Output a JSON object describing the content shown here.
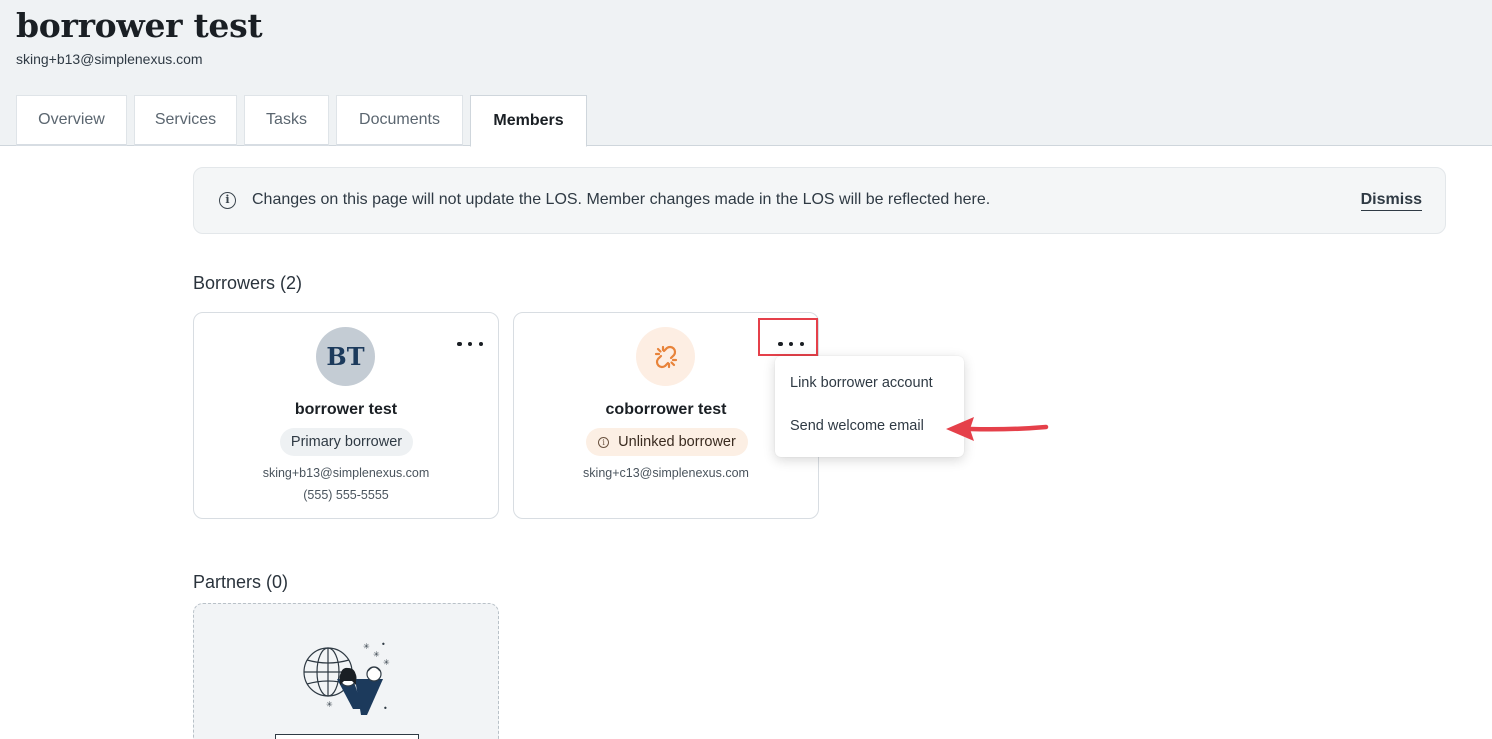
{
  "header": {
    "title": "borrower test",
    "subtitle": "sking+b13@simplenexus.com"
  },
  "tabs": [
    {
      "label": "Overview"
    },
    {
      "label": "Services"
    },
    {
      "label": "Tasks"
    },
    {
      "label": "Documents"
    },
    {
      "label": "Members",
      "active": true
    }
  ],
  "banner": {
    "icon": "info-icon",
    "text": "Changes on this page will not update the LOS. Member changes made in the LOS will be reflected here.",
    "dismiss_label": "Dismiss"
  },
  "borrowers": {
    "title": "Borrowers (2)",
    "cards": [
      {
        "avatar_initials": "BT",
        "name": "borrower test",
        "role": "Primary borrower",
        "email": "sking+b13@simplenexus.com",
        "phone": "(555) 555-5555",
        "menu_icon": "more-horizontal-icon"
      },
      {
        "avatar_icon": "broken-link-icon",
        "name": "coborrower test",
        "role": "Unlinked borrower",
        "role_icon": "info-icon",
        "email": "sking+c13@simplenexus.com",
        "menu_icon": "more-horizontal-icon"
      }
    ]
  },
  "menu": {
    "items": [
      {
        "label": "Link borrower account"
      },
      {
        "label": "Send welcome email"
      }
    ]
  },
  "partners": {
    "title": "Partners (0)",
    "illustration": "globe-partners-illustration"
  },
  "colors": {
    "header_bg": "#eff2f4",
    "highlight_red": "#e5404a",
    "unlinked_bg": "#fcefe4",
    "link_icon_orange": "#e8833a"
  }
}
